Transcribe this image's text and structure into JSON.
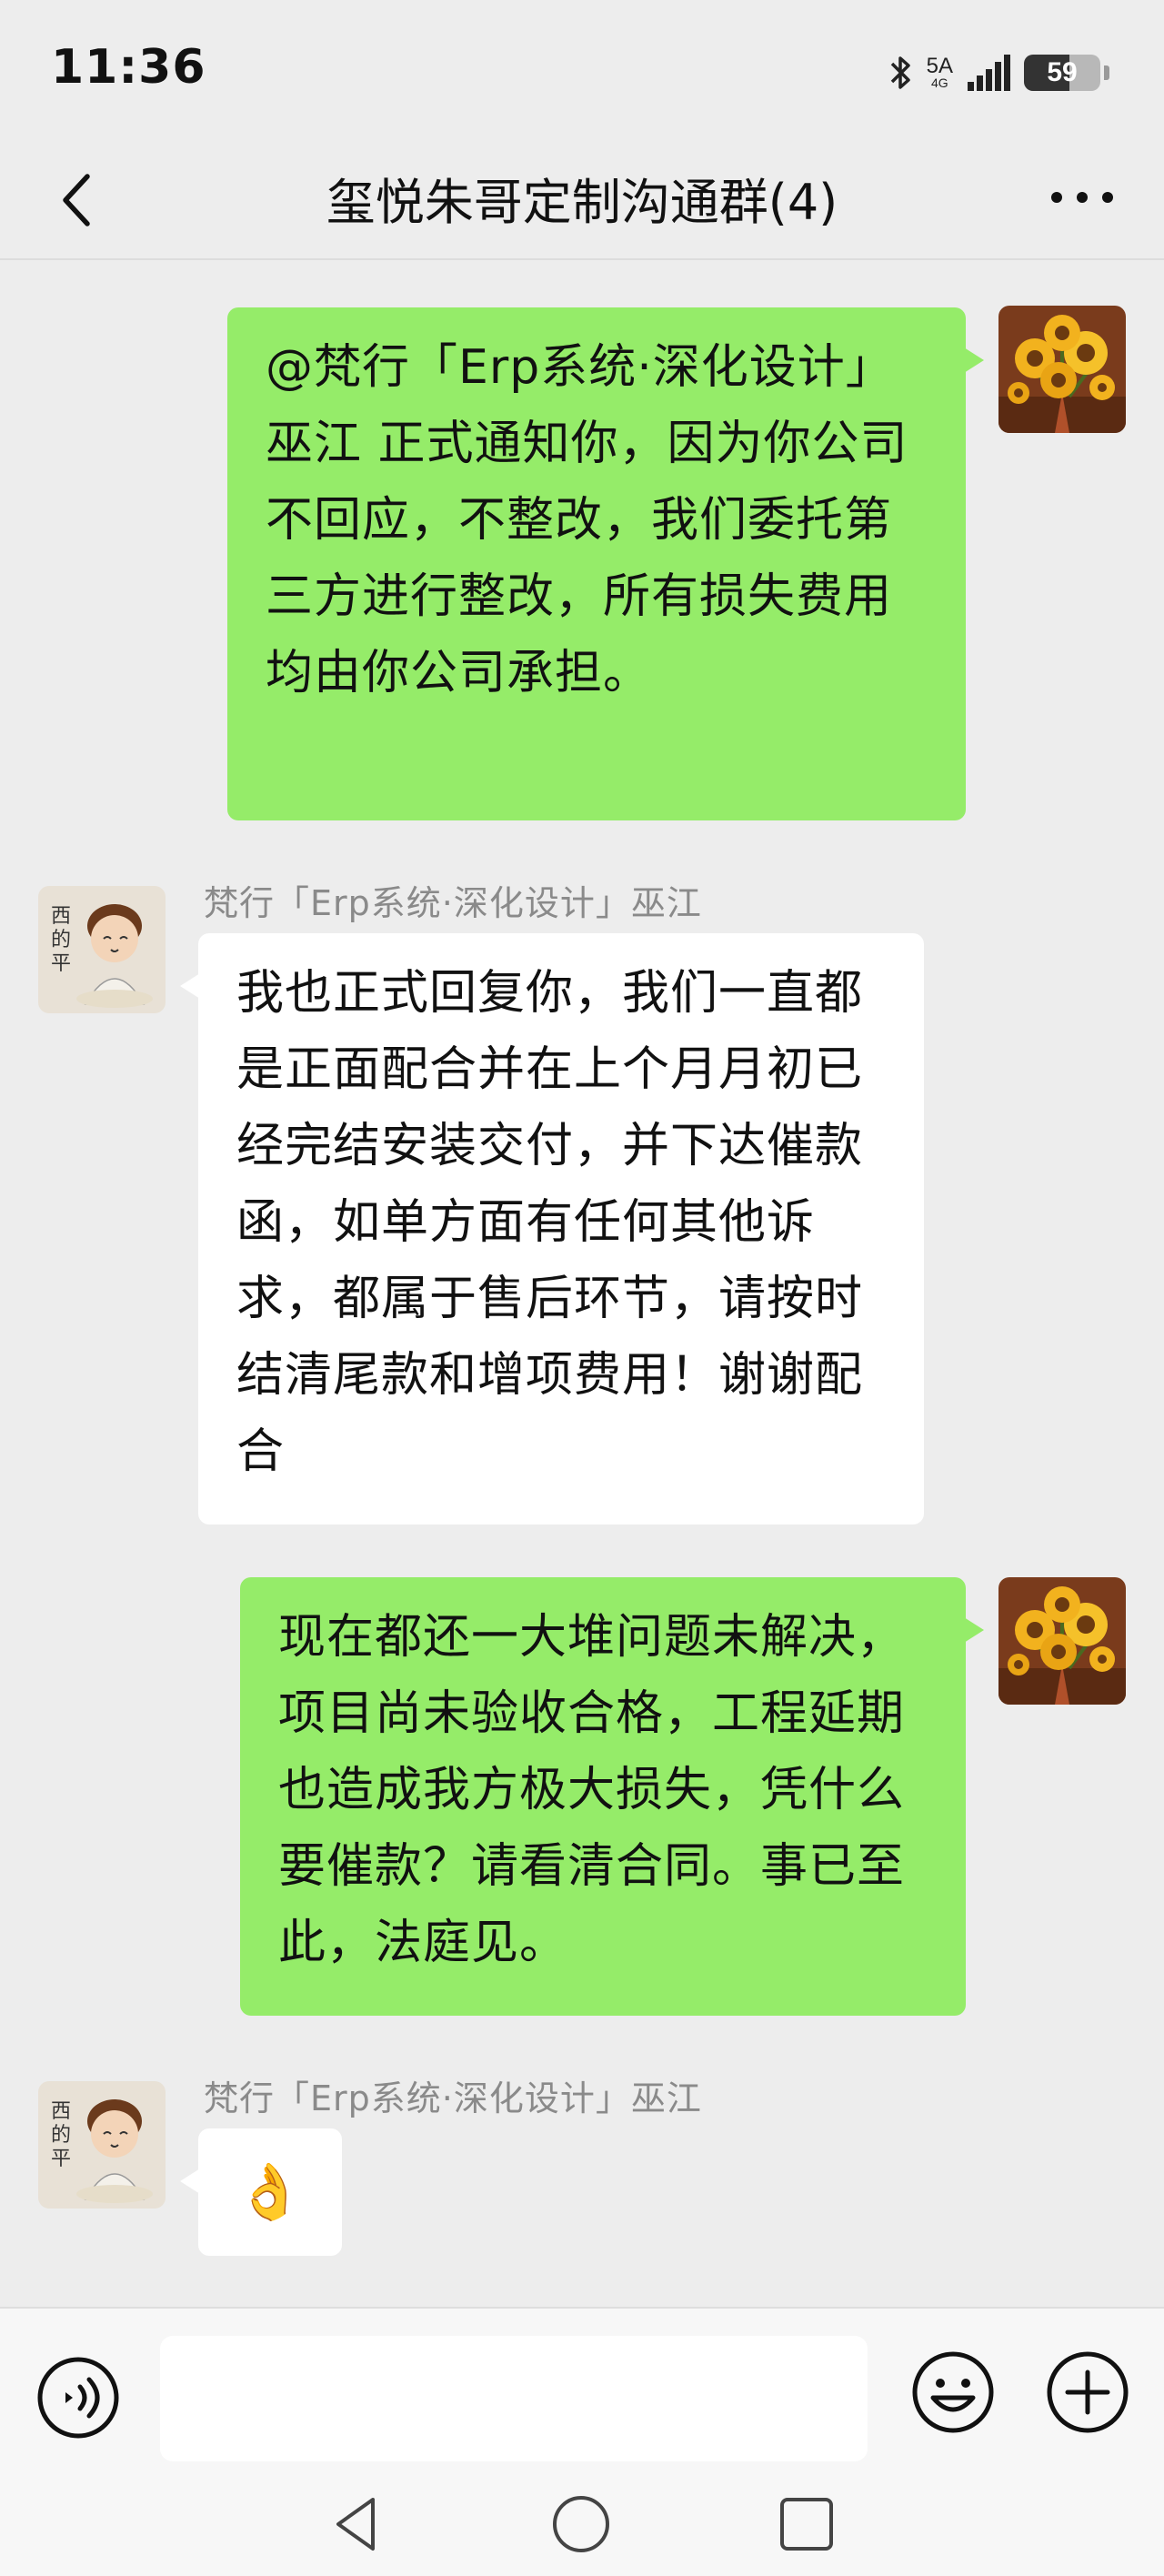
{
  "status_bar": {
    "time": "11:36",
    "network": "5A",
    "network_sub": "4G",
    "battery_level": "59",
    "battery_fraction": 0.59
  },
  "header": {
    "title": "玺悦朱哥定制沟通群(4)"
  },
  "messages": [
    {
      "side": "right",
      "text": "@梵行「Erp系统·深化设计」巫江 正式通知你，因为你公司不回应，不整改，我们委托第三方进行整改，所有损失费用均由你公司承担。"
    },
    {
      "side": "left",
      "sender": "梵行「Erp系统·深化设计」巫江",
      "text": "我也正式回复你，我们一直都是正面配合并在上个月月初已经完结安装交付，并下达催款函，如单方面有任何其他诉求，都属于售后环节，请按时结清尾款和增项费用！谢谢配合"
    },
    {
      "side": "right",
      "text": "现在都还一大堆问题未解决，项目尚未验收合格，工程延期也造成我方极大损失，凭什么要催款？请看清合同。事已至此，法庭见。"
    },
    {
      "side": "left",
      "sender": "梵行「Erp系统·深化设计」巫江",
      "emoji": "👌"
    }
  ],
  "colors": {
    "background": "#ededed",
    "my_bubble": "#95ec69",
    "their_bubble": "#ffffff"
  },
  "icons": {
    "back": "chevron-left-icon",
    "more": "more-dots-icon",
    "voice": "voice-icon",
    "emoji": "smiley-icon",
    "plus": "plus-icon"
  }
}
